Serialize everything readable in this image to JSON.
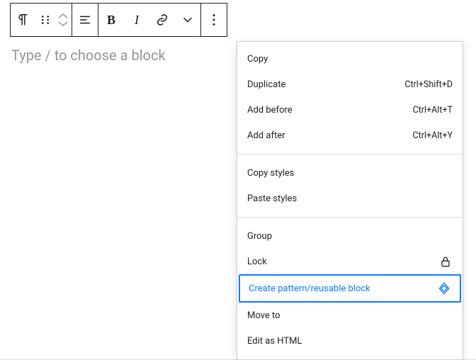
{
  "colors": {
    "highlight": "#0a7cff"
  },
  "editor": {
    "placeholder": "Type / to choose a block"
  },
  "menu": {
    "items": [
      {
        "label": "Copy"
      },
      {
        "label": "Duplicate",
        "shortcut": "Ctrl+Shift+D"
      },
      {
        "label": "Add before",
        "shortcut": "Ctrl+Alt+T"
      },
      {
        "label": "Add after",
        "shortcut": "Ctrl+Alt+Y"
      }
    ],
    "styles": [
      {
        "label": "Copy styles"
      },
      {
        "label": "Paste styles"
      }
    ],
    "actions": [
      {
        "label": "Group"
      },
      {
        "label": "Lock",
        "icon": "lock"
      },
      {
        "label": "Create pattern/reusable block",
        "icon": "diamond",
        "highlight": true
      },
      {
        "label": "Move to"
      },
      {
        "label": "Edit as HTML"
      }
    ]
  }
}
